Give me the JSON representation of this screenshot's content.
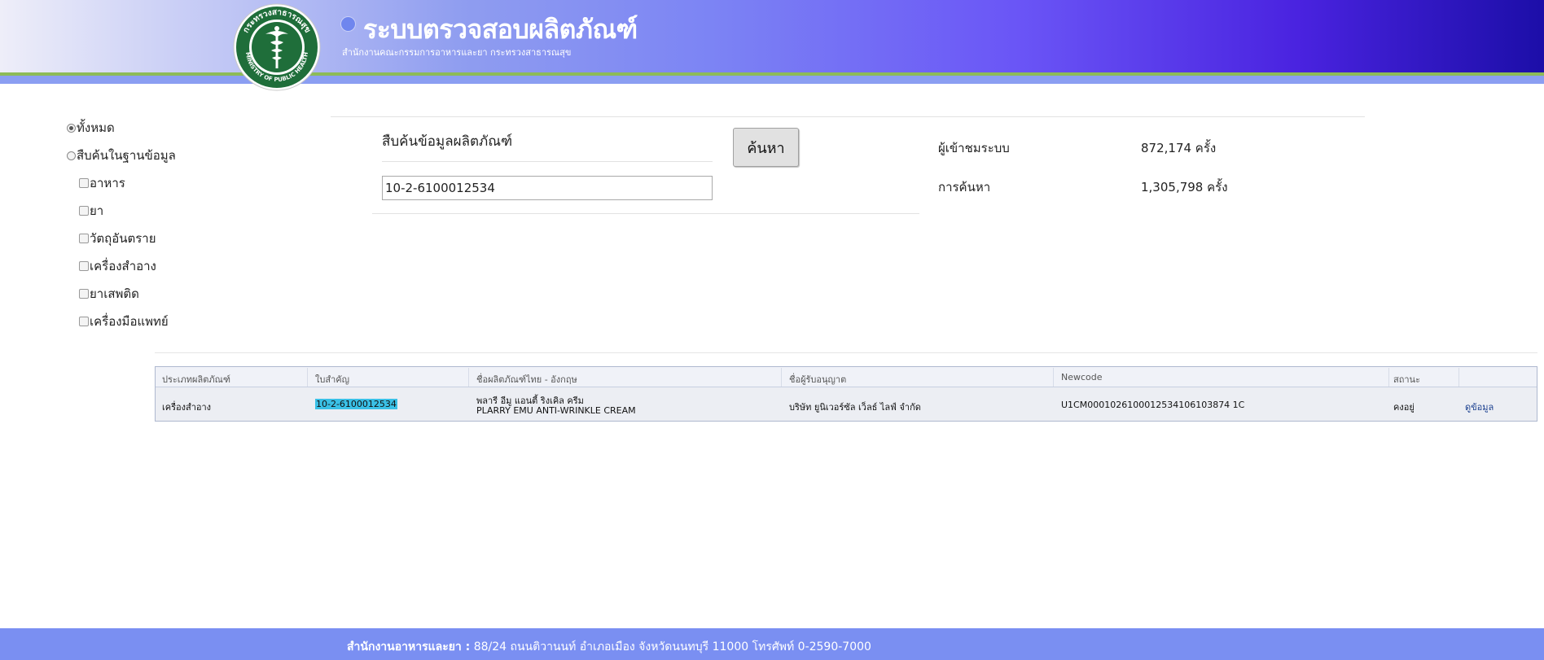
{
  "header": {
    "title": "ระบบตรวจสอบผลิตภัณฑ์",
    "subtitle": "สำนักงานคณะกรรมการอาหารและยา กระทรวงสาธารณสุข",
    "logo_top_text": "กระทรวงสาธารณสุข",
    "logo_bottom_text": "MINISTRY OF PUBLIC HEALTH"
  },
  "filter": {
    "radio_all": "ทั้งหมด",
    "radio_db": "สืบค้นในฐานข้อมูล",
    "checks": [
      "อาหาร",
      "ยา",
      "วัตถุอันตราย",
      "เครื่องสำอาง",
      "ยาเสพติด",
      "เครื่องมือแพทย์"
    ]
  },
  "search": {
    "title": "สืบค้นข้อมูลผลิตภัณฑ์",
    "value": "10-2-6100012534",
    "button": "ค้นหา"
  },
  "stats": {
    "visitors_label": "ผู้เข้าชมระบบ",
    "visitors_value": "872,174 ครั้ง",
    "searches_label": "การค้นหา",
    "searches_value": "1,305,798 ครั้ง"
  },
  "table": {
    "headers": [
      "ประเภทผลิตภัณฑ์",
      "ใบสำคัญ",
      "ชื่อผลิตภัณฑ์ไทย - อังกฤษ",
      "ชื่อผู้รับอนุญาต",
      "Newcode",
      "สถานะ",
      ""
    ],
    "rows": [
      {
        "type": "เครื่องสำอาง",
        "license": "10-2-6100012534",
        "name_th": "พลารี อีมู แอนตี้ ริงเคิล ครีม",
        "name_en": "PLARRY EMU ANTI-WRINKLE CREAM",
        "licensee": "บริษัท ยูนิเวอร์ซัล เว็ลธ์ ไลฟ์ จำกัด",
        "newcode": "U1CM0001026100012534106103874 1C",
        "status": "คงอยู่",
        "action": "ดูข้อมูล"
      }
    ]
  },
  "footer": {
    "org": "สำนักงานอาหารและยา :",
    "address": "88/24 ถนนติวานนท์ อำเภอเมือง จังหวัดนนทบุรี 11000 โทรศัพท์ 0-2590-7000"
  },
  "colors": {
    "header_start": "#eeeef9",
    "header_end": "#1c0ea8",
    "accent_green": "#8dbb57",
    "footer": "#7a8ff2",
    "highlight": "#3ac0e6"
  }
}
